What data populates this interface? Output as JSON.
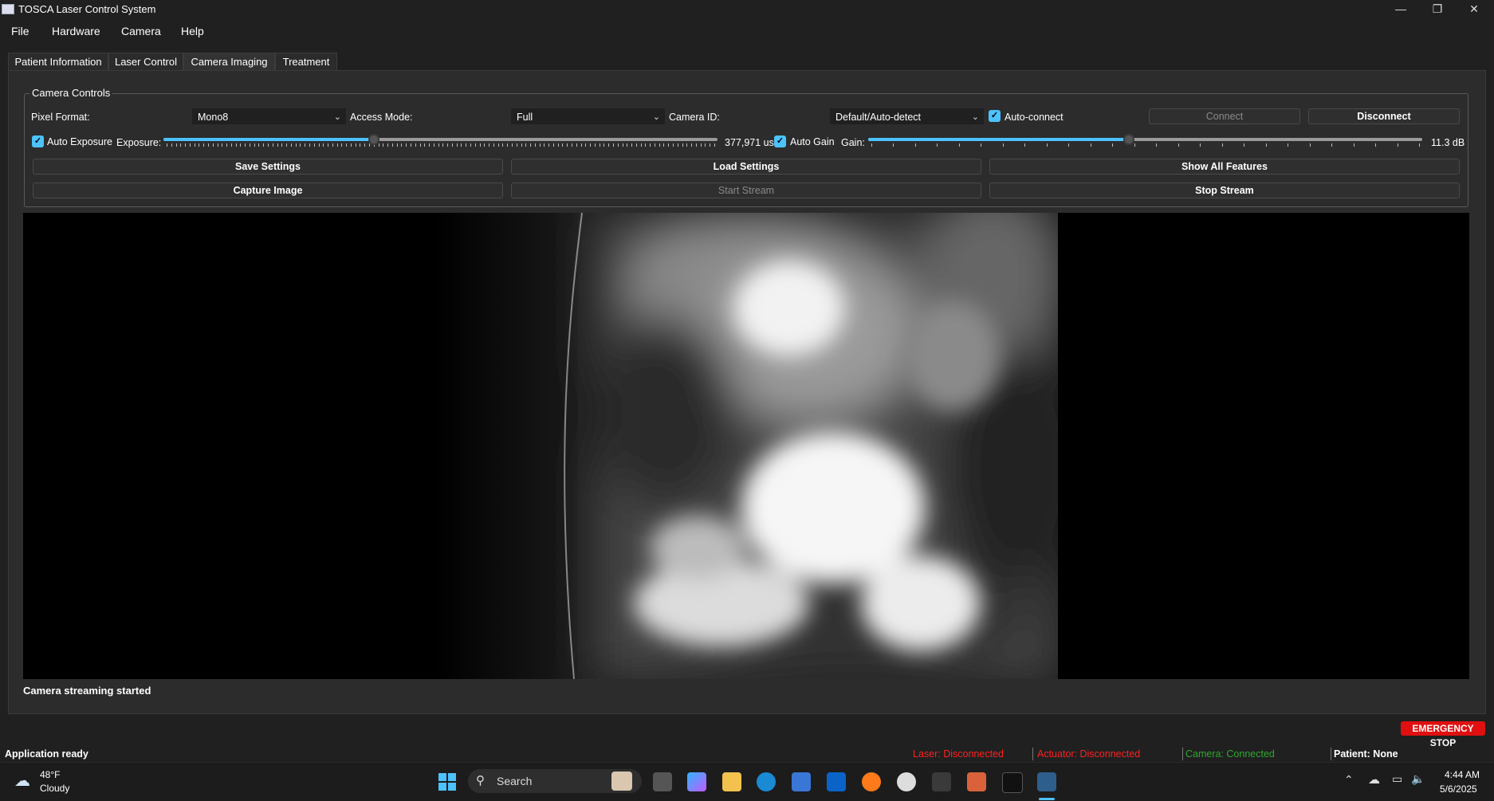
{
  "window": {
    "title": "TOSCA Laser Control System"
  },
  "menu": [
    "File",
    "Hardware",
    "Camera",
    "Help"
  ],
  "tabs": [
    "Patient Information",
    "Laser Control",
    "Camera  Imaging",
    "Treatment"
  ],
  "active_tab": "Camera  Imaging",
  "camera_controls": {
    "title": "Camera Controls",
    "pixel_format_label": "Pixel Format:",
    "pixel_format_value": "Mono8",
    "access_mode_label": "Access Mode:",
    "access_mode_value": "Full",
    "camera_id_label": "Camera ID:",
    "camera_id_value": "Default/Auto-detect",
    "auto_connect_label": "Auto-connect",
    "auto_connect_checked": true,
    "connect_label": "Connect",
    "disconnect_label": "Disconnect",
    "auto_exposure_label": "Auto Exposure",
    "auto_exposure_checked": true,
    "exposure_label": "Exposure:",
    "exposure_value": "377,971 us",
    "exposure_level": 0.38,
    "auto_gain_label": "Auto Gain",
    "auto_gain_checked": true,
    "gain_label": "Gain:",
    "gain_value": "11.3 dB",
    "gain_level": 0.47,
    "save_settings_label": "Save Settings",
    "load_settings_label": "Load Settings",
    "show_all_features_label": "Show All Features",
    "capture_image_label": "Capture Image",
    "start_stream_label": "Start Stream",
    "stop_stream_label": "Stop Stream"
  },
  "camera_status_message": "Camera streaming started",
  "emergency_stop_label": "EMERGENCY STOP",
  "status_bar": {
    "app_status": "Application ready",
    "laser": "Laser: Disconnected",
    "actuator": "Actuator: Disconnected",
    "camera": "Camera: Connected",
    "patient": "Patient: None"
  },
  "colors": {
    "accent": "#4cc2ff",
    "disconnected": "#ff2020",
    "connected": "#2fa82f",
    "estop": "#e01010"
  },
  "taskbar": {
    "weather_temp": "48°F",
    "weather_desc": "Cloudy",
    "search_label": "Search",
    "time": "4:44 AM",
    "date": "5/6/2025",
    "apps": [
      "windows-start-icon",
      "task-view-icon",
      "copilot-icon",
      "file-explorer-icon",
      "edge-icon",
      "store-icon",
      "outlook-icon",
      "firefox-icon",
      "aperture-icon",
      "terminal-icon",
      "claude-icon",
      "cube-app-icon",
      "python-app-icon"
    ]
  }
}
